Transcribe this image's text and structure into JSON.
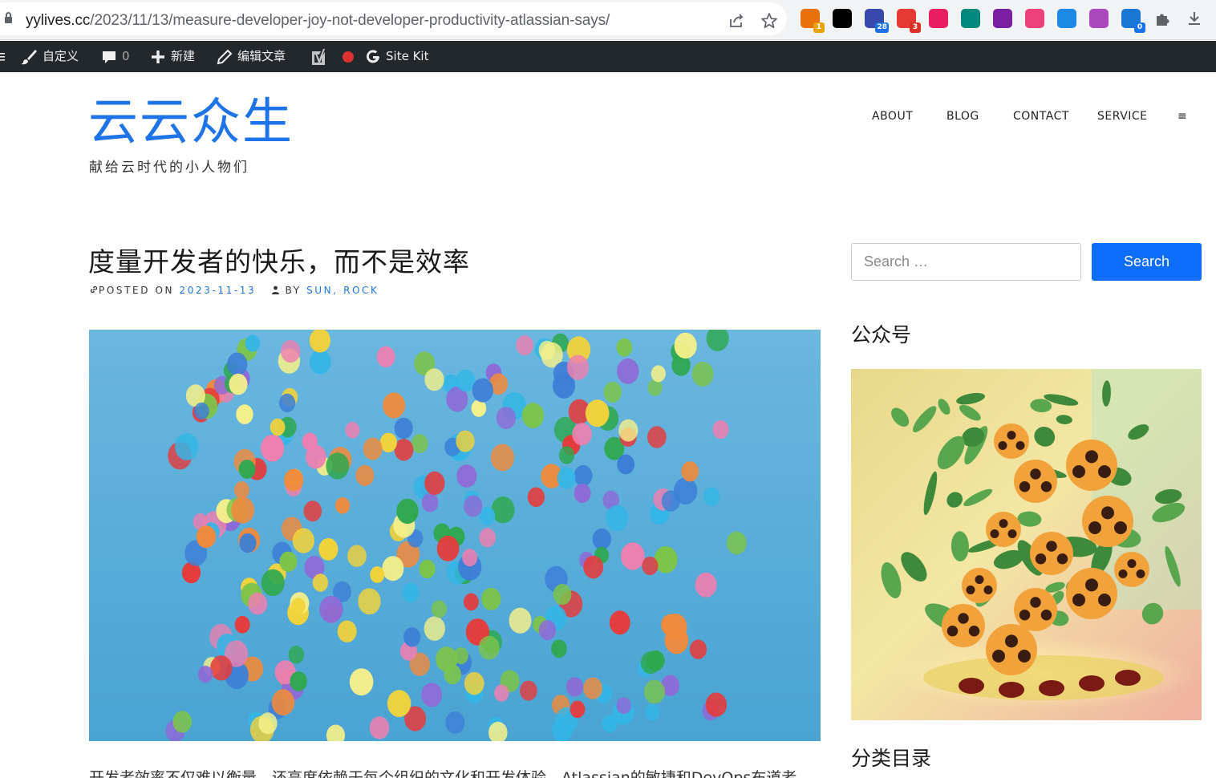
{
  "browser": {
    "url_host": "yylives.cc",
    "url_path": "/2023/11/13/measure-developer-joy-not-developer-productivity-atlassian-says/",
    "extensions": [
      {
        "name": "extension-1-icon",
        "badge": "1",
        "color": "#e8710a"
      },
      {
        "name": "notion-icon",
        "badge": "",
        "color": "#000000"
      },
      {
        "name": "extension-3-icon",
        "badge": "28",
        "color": "#3949ab"
      },
      {
        "name": "extension-4-icon",
        "badge": "3",
        "color": "#e53935"
      },
      {
        "name": "translate-icon",
        "badge": "",
        "color": "#e91e63"
      },
      {
        "name": "extension-6-icon",
        "badge": "",
        "color": "#00897b"
      },
      {
        "name": "extension-7-icon",
        "badge": "",
        "color": "#7b1fa2"
      },
      {
        "name": "extension-8-icon",
        "badge": "",
        "color": "#ec407a"
      },
      {
        "name": "extension-9-icon",
        "badge": "",
        "color": "#1e88e5"
      },
      {
        "name": "openai-icon",
        "badge": "",
        "color": "#ab47bc"
      },
      {
        "name": "extension-11-icon",
        "badge": "0",
        "color": "#1976d2"
      }
    ]
  },
  "adminbar": {
    "customize": "自定义",
    "comments_count": "0",
    "new": "新建",
    "edit_post": "编辑文章",
    "site_kit": "Site Kit"
  },
  "site": {
    "title": "云云众生",
    "tagline": "献给云时代的小人物们",
    "accent": "#1e73e8"
  },
  "nav": {
    "items": [
      "ABOUT",
      "BLOG",
      "CONTACT",
      "SERVICE"
    ],
    "menu_toggle": "≡"
  },
  "post": {
    "title": "度量开发者的快乐，而不是效率",
    "posted_on_label": "POSTED ON",
    "date": "2023-11-13",
    "by_label": "BY",
    "author": "SUN, ROCK",
    "excerpt": "开发者效率不仅难以衡量，还高度依赖于每个组织的文化和开发体验。Atlassian的敏捷和DevOps布道者"
  },
  "sidebar": {
    "search_placeholder": "Search …",
    "search_button": "Search",
    "widget1_title": "公众号",
    "widget2_title": "分类目录"
  }
}
